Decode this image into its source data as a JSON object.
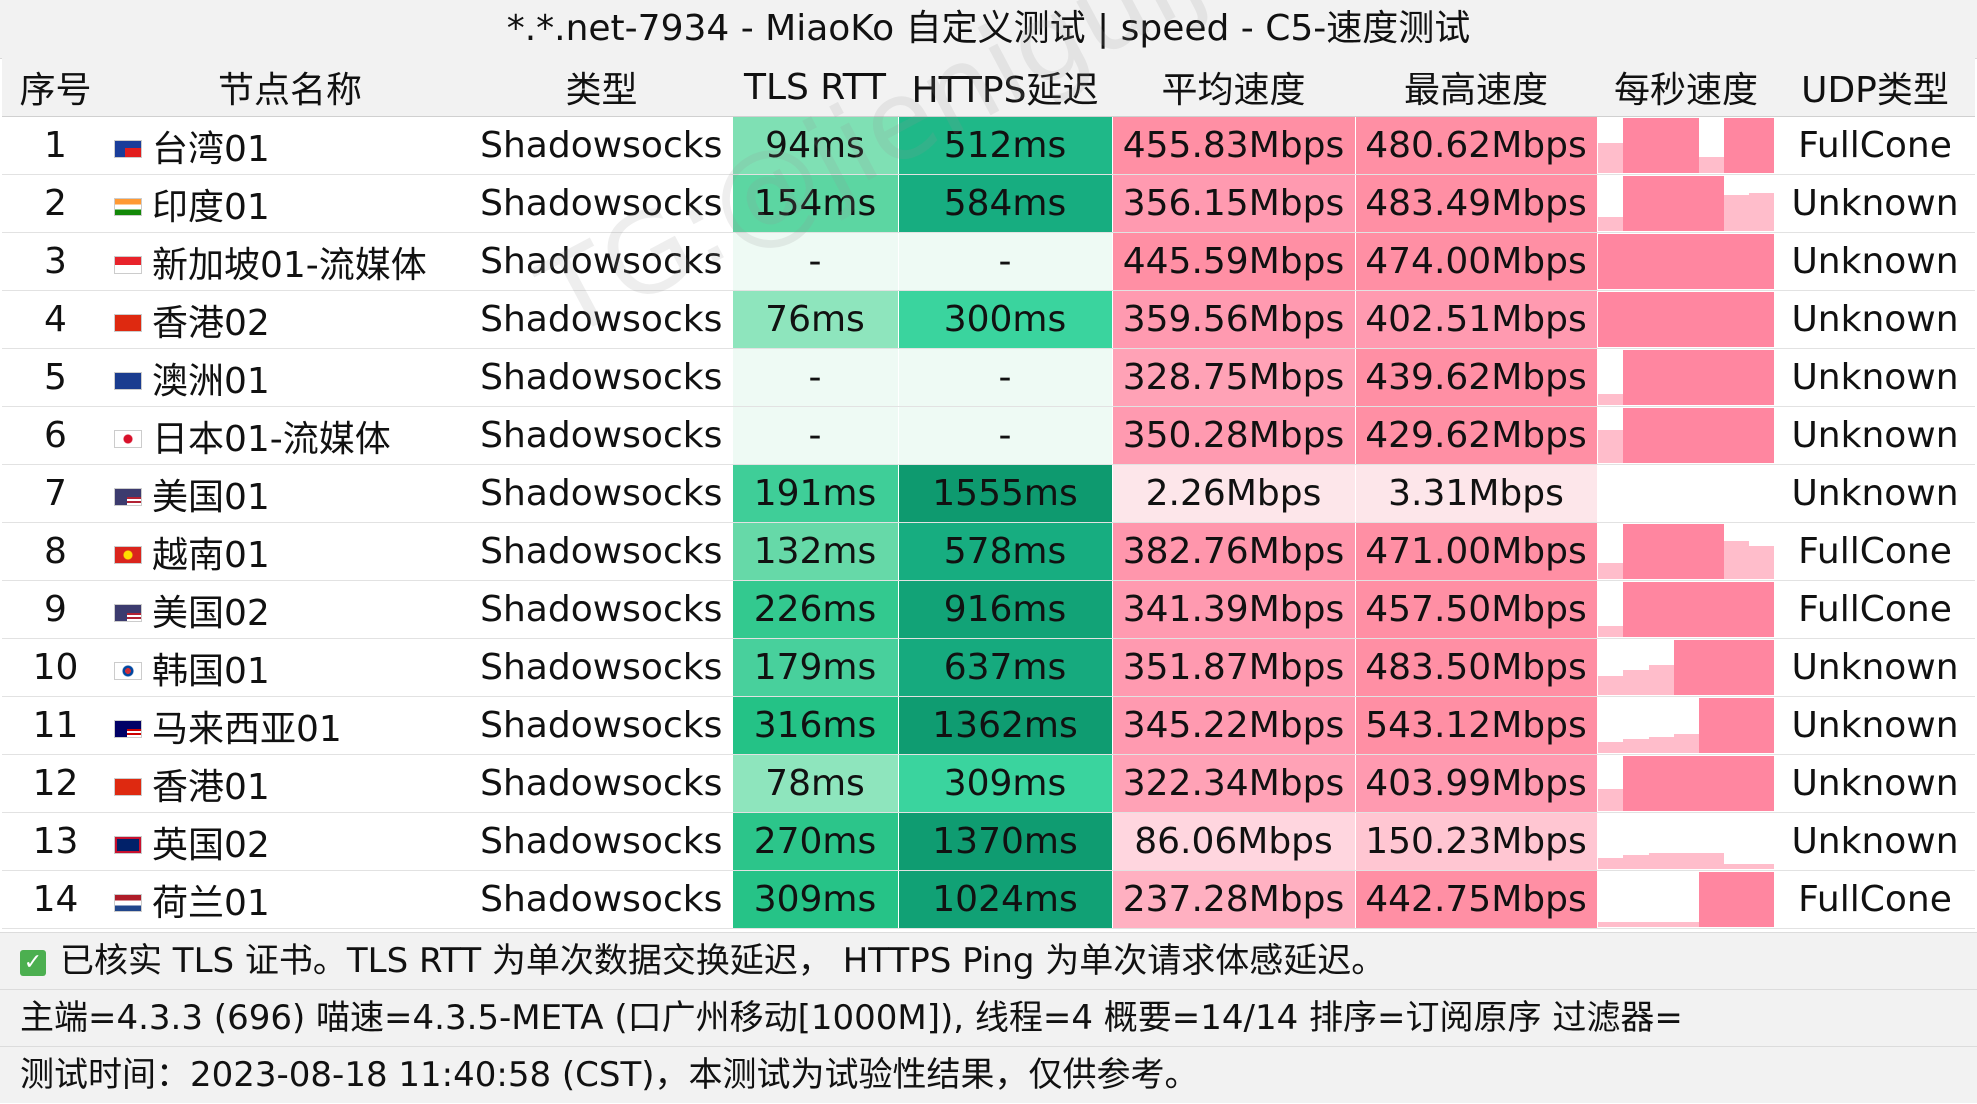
{
  "title": "*.*.net-7934 - MiaoKo 自定义测试 | speed - C5-速度测试",
  "headers": [
    "序号",
    "节点名称",
    "类型",
    "TLS RTT",
    "HTTPS延迟",
    "平均速度",
    "最高速度",
    "每秒速度",
    "UDP类型"
  ],
  "rows": [
    {
      "no": "1",
      "flag": "taiwan-flag",
      "name": "台湾01",
      "type": "Shadowsocks",
      "rtt": "94ms",
      "https": "512ms",
      "avg": "455.83Mbps",
      "max": "480.62Mbps",
      "udp": "FullCone",
      "rtt_color": "#7fe0b4",
      "https_color": "#1fb888",
      "avg_color": "#ff8fa4",
      "max_color": "#ff8fa4",
      "spark": [
        0.55,
        1,
        1,
        1,
        0.3,
        1,
        1
      ]
    },
    {
      "no": "2",
      "flag": "india-flag",
      "name": "印度01",
      "type": "Shadowsocks",
      "rtt": "154ms",
      "https": "584ms",
      "avg": "356.15Mbps",
      "max": "483.49Mbps",
      "udp": "Unknown",
      "rtt_color": "#5cd6a2",
      "https_color": "#17ad80",
      "avg_color": "#ff9ab0",
      "max_color": "#ff8fa4",
      "spark": [
        0.25,
        1,
        1,
        1,
        1,
        0.65,
        0.7
      ]
    },
    {
      "no": "3",
      "flag": "singapore-flag",
      "name": "新加坡01-流媒体",
      "type": "Shadowsocks",
      "rtt": "-",
      "https": "-",
      "avg": "445.59Mbps",
      "max": "474.00Mbps",
      "udp": "Unknown",
      "rtt_color": "#eefaf4",
      "https_color": "#eefaf4",
      "avg_color": "#ff8fa4",
      "max_color": "#ff8fa4",
      "spark": [
        1,
        1,
        1,
        1,
        1,
        1,
        1
      ]
    },
    {
      "no": "4",
      "flag": "hongkong-flag",
      "name": "香港02",
      "type": "Shadowsocks",
      "rtt": "76ms",
      "https": "300ms",
      "avg": "359.56Mbps",
      "max": "402.51Mbps",
      "udp": "Unknown",
      "rtt_color": "#8ee5bd",
      "https_color": "#3ad49e",
      "avg_color": "#ff9ab0",
      "max_color": "#ff9ab0",
      "spark": [
        1,
        1,
        1,
        1,
        1,
        1,
        1
      ]
    },
    {
      "no": "5",
      "flag": "australia-flag",
      "name": "澳洲01",
      "type": "Shadowsocks",
      "rtt": "-",
      "https": "-",
      "avg": "328.75Mbps",
      "max": "439.62Mbps",
      "udp": "Unknown",
      "rtt_color": "#eefaf4",
      "https_color": "#eefaf4",
      "avg_color": "#ffa2b6",
      "max_color": "#ff8fa4",
      "spark": [
        0.2,
        1,
        1,
        1,
        1,
        1,
        1
      ]
    },
    {
      "no": "6",
      "flag": "japan-flag",
      "name": "日本01-流媒体",
      "type": "Shadowsocks",
      "rtt": "-",
      "https": "-",
      "avg": "350.28Mbps",
      "max": "429.62Mbps",
      "udp": "Unknown",
      "rtt_color": "#eefaf4",
      "https_color": "#eefaf4",
      "avg_color": "#ff9ab0",
      "max_color": "#ff8fa4",
      "spark": [
        0.6,
        1,
        1,
        1,
        1,
        1,
        1
      ]
    },
    {
      "no": "7",
      "flag": "usa-flag",
      "name": "美国01",
      "type": "Shadowsocks",
      "rtt": "191ms",
      "https": "1555ms",
      "avg": "2.26Mbps",
      "max": "3.31Mbps",
      "udp": "Unknown",
      "rtt_color": "#3fce98",
      "https_color": "#0e9a6f",
      "avg_color": "#fde6ea",
      "max_color": "#fde6ea",
      "spark": [
        0,
        0,
        0,
        0,
        0,
        0,
        0
      ]
    },
    {
      "no": "8",
      "flag": "vietnam-flag",
      "name": "越南01",
      "type": "Shadowsocks",
      "rtt": "132ms",
      "https": "578ms",
      "avg": "382.76Mbps",
      "max": "471.00Mbps",
      "udp": "FullCone",
      "rtt_color": "#66d9a8",
      "https_color": "#17ad80",
      "avg_color": "#ff96ac",
      "max_color": "#ff8fa4",
      "spark": [
        0.3,
        1,
        1,
        1,
        1,
        0.7,
        0.6
      ]
    },
    {
      "no": "9",
      "flag": "usa-flag",
      "name": "美国02",
      "type": "Shadowsocks",
      "rtt": "226ms",
      "https": "916ms",
      "avg": "341.39Mbps",
      "max": "457.50Mbps",
      "udp": "FullCone",
      "rtt_color": "#33c98f",
      "https_color": "#12a377",
      "avg_color": "#ff9ab0",
      "max_color": "#ff8fa4",
      "spark": [
        0.2,
        1,
        1,
        1,
        1,
        1,
        1
      ]
    },
    {
      "no": "10",
      "flag": "korea-flag",
      "name": "韩国01",
      "type": "Shadowsocks",
      "rtt": "179ms",
      "https": "637ms",
      "avg": "351.87Mbps",
      "max": "483.50Mbps",
      "udp": "Unknown",
      "rtt_color": "#48d09c",
      "https_color": "#16aa7e",
      "avg_color": "#ff9ab0",
      "max_color": "#ff8fa4",
      "spark": [
        0.35,
        0.45,
        0.55,
        1,
        1,
        1,
        1
      ]
    },
    {
      "no": "11",
      "flag": "malaysia-flag",
      "name": "马来西亚01",
      "type": "Shadowsocks",
      "rtt": "316ms",
      "https": "1362ms",
      "avg": "345.22Mbps",
      "max": "543.12Mbps",
      "udp": "Unknown",
      "rtt_color": "#24c286",
      "https_color": "#0f9c71",
      "avg_color": "#ff9ab0",
      "max_color": "#ff8fa4",
      "spark": [
        0.2,
        0.25,
        0.3,
        0.35,
        1,
        1,
        1
      ]
    },
    {
      "no": "12",
      "flag": "hongkong-flag",
      "name": "香港01",
      "type": "Shadowsocks",
      "rtt": "78ms",
      "https": "309ms",
      "avg": "322.34Mbps",
      "max": "403.99Mbps",
      "udp": "Unknown",
      "rtt_color": "#8ee5bd",
      "https_color": "#3ad49e",
      "avg_color": "#ffa2b6",
      "max_color": "#ff9ab0",
      "spark": [
        0.4,
        1,
        1,
        1,
        1,
        1,
        1
      ]
    },
    {
      "no": "13",
      "flag": "uk-flag",
      "name": "英国02",
      "type": "Shadowsocks",
      "rtt": "270ms",
      "https": "1370ms",
      "avg": "86.06Mbps",
      "max": "150.23Mbps",
      "udp": "Unknown",
      "rtt_color": "#2cc58a",
      "https_color": "#0f9c71",
      "avg_color": "#ffd6df",
      "max_color": "#ffc6d2",
      "spark": [
        0.2,
        0.25,
        0.3,
        0.3,
        0.3,
        0.1,
        0.1
      ]
    },
    {
      "no": "14",
      "flag": "netherlands-flag",
      "name": "荷兰01",
      "type": "Shadowsocks",
      "rtt": "309ms",
      "https": "1024ms",
      "avg": "237.28Mbps",
      "max": "442.75Mbps",
      "udp": "FullCone",
      "rtt_color": "#26c387",
      "https_color": "#11a175",
      "avg_color": "#ffb0c1",
      "max_color": "#ff8fa4",
      "spark": [
        0.1,
        0.1,
        0.1,
        0.1,
        1,
        1,
        1
      ]
    }
  ],
  "footer": {
    "tls_note": "已核实 TLS 证书。TLS RTT 为单次数据交换延迟， HTTPS Ping 为单次请求体感延迟。",
    "backend": "主端=4.3.3 (696) 喵速=4.3.5-META (口广州移动[1000M]), 线程=4 概要=14/14 排序=订阅原序 过滤器=",
    "test_time": "测试时间：2023-08-18 11:40:58 (CST)，本测试为试验性结果，仅供参考。"
  },
  "watermark": "TG:@jieniguijichang-gy",
  "colors": {
    "spark_bar": "#ff86a0",
    "header_bg": "#f2f2f2"
  }
}
